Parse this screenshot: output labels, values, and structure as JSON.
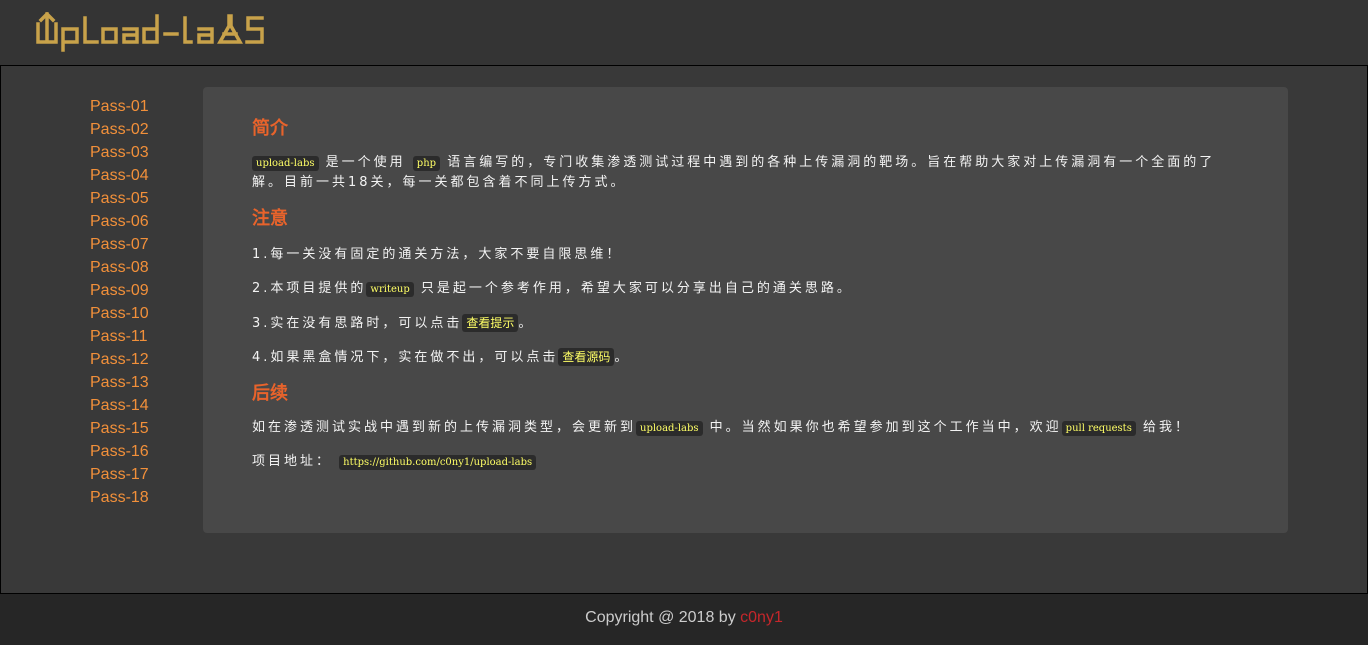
{
  "header": {
    "logo_text": "UpLoad-labS",
    "logo_color": "#c8a24a"
  },
  "sidebar": {
    "items": [
      "Pass-01",
      "Pass-02",
      "Pass-03",
      "Pass-04",
      "Pass-05",
      "Pass-06",
      "Pass-07",
      "Pass-08",
      "Pass-09",
      "Pass-10",
      "Pass-11",
      "Pass-12",
      "Pass-13",
      "Pass-14",
      "Pass-15",
      "Pass-16",
      "Pass-17",
      "Pass-18"
    ]
  },
  "content": {
    "intro": {
      "title": "简介",
      "code1": "upload-labs",
      "text1": "是一个使用",
      "code2": "php",
      "text2": "语言编写的，专门收集渗透测试过程中遇到的各种上传漏洞的靶场。旨在帮助大家对上传漏洞有一个全面的了解。目前一共18关，每一关都包含着不同上传方式。"
    },
    "notice": {
      "title": "注意",
      "item1": "1.每一关没有固定的通关方法，大家不要自限思维！",
      "item2_pre": "2.本项目提供的",
      "item2_code": "writeup",
      "item2_post": "只是起一个参考作用，希望大家可以分享出自己的通关思路。",
      "item3_pre": "3.实在没有思路时，可以点击",
      "item3_link": "查看提示",
      "item3_post": "。",
      "item4_pre": "4.如果黑盒情况下，实在做不出，可以点击",
      "item4_link": "查看源码",
      "item4_post": "。"
    },
    "followup": {
      "title": "后续",
      "text_pre": "如在渗透测试实战中遇到新的上传漏洞类型，会更新到",
      "code1": "upload-labs",
      "text_mid": "中。当然如果你也希望参加到这个工作当中，欢迎",
      "code2": "pull requests",
      "text_post": "给我！",
      "addr_label": "项目地址：",
      "addr_url": "https://github.com/c0ny1/upload-labs"
    }
  },
  "footer": {
    "copyright": "Copyright @ 2018 by ",
    "author": "c0ny1"
  },
  "colors": {
    "page_bg": "#393939",
    "header_bg": "#343434",
    "content_bg": "#484848",
    "footer_bg": "#262626",
    "menu_link": "#f2903a",
    "section_title": "#e8632b",
    "code_text": "#ffff66",
    "author": "#c5262b"
  }
}
